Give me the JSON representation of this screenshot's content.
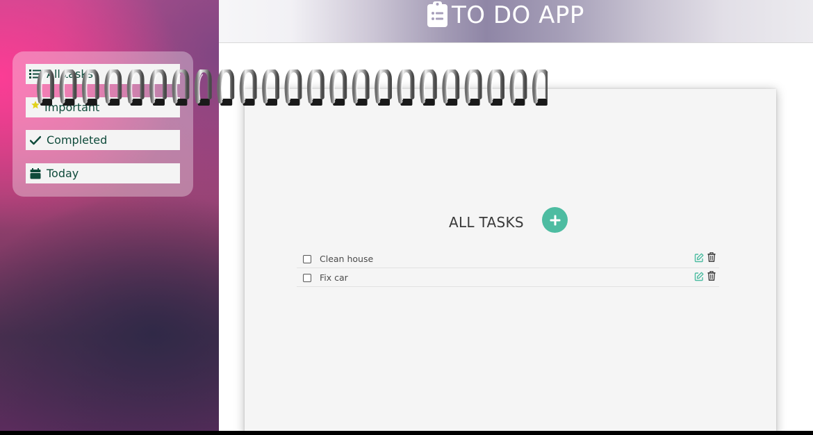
{
  "header": {
    "title": "TO DO APP",
    "icon": "clipboard-list-icon"
  },
  "sidebar": {
    "items": [
      {
        "label": "All tasks",
        "icon": "list-icon"
      },
      {
        "label": "Important",
        "icon": "star-icon"
      },
      {
        "label": "Completed",
        "icon": "check-icon"
      },
      {
        "label": "Today",
        "icon": "calendar-icon"
      }
    ]
  },
  "main": {
    "list_title": "ALL TASKS",
    "add_icon": "plus-icon",
    "tasks": [
      {
        "text": "Clean house",
        "checked": false
      },
      {
        "text": "Fix car",
        "checked": false
      }
    ]
  },
  "colors": {
    "accent": "#4dbca1",
    "nav_text": "#0e4a3a",
    "star": "#e2d21c"
  }
}
